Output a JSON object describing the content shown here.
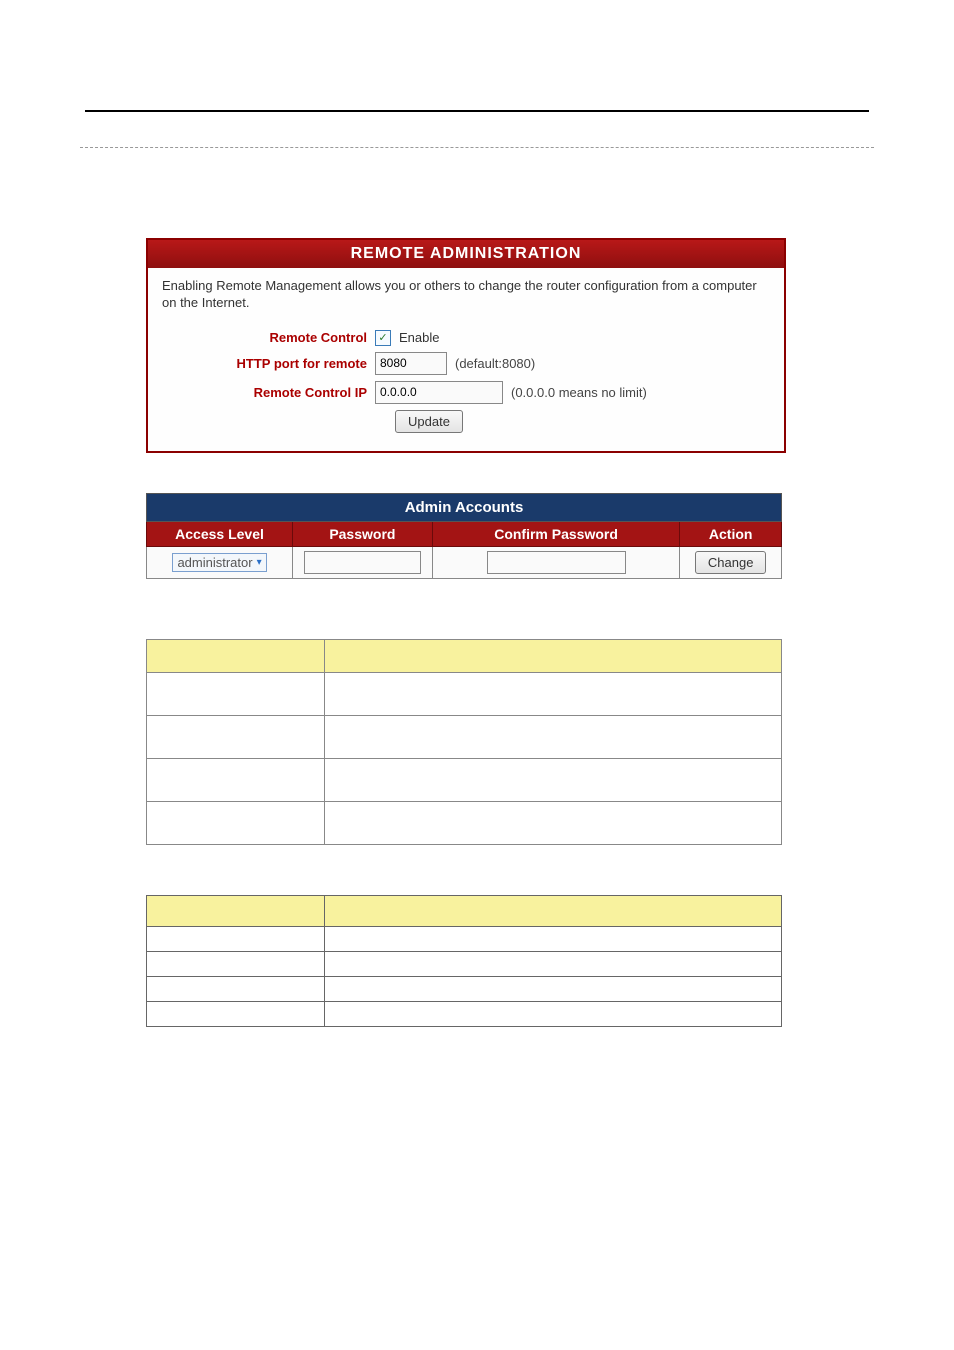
{
  "remote_admin": {
    "title": "REMOTE ADMINISTRATION",
    "description": "Enabling Remote Management allows you or others to change the router configuration from a computer on the Internet.",
    "remote_control_label": "Remote Control",
    "enable_label": "Enable",
    "enable_checked": true,
    "http_port_label": "HTTP port for remote",
    "http_port_value": "8080",
    "http_port_hint": "(default:8080)",
    "remote_ip_label": "Remote Control IP",
    "remote_ip_value": "0.0.0.0",
    "remote_ip_hint": "(0.0.0.0 means no limit)",
    "update_label": "Update"
  },
  "accounts": {
    "title": "Admin Accounts",
    "headers": {
      "access_level": "Access Level",
      "password": "Password",
      "confirm_password": "Confirm Password",
      "action": "Action"
    },
    "row": {
      "access_level_value": "administrator",
      "change_label": "Change"
    }
  }
}
